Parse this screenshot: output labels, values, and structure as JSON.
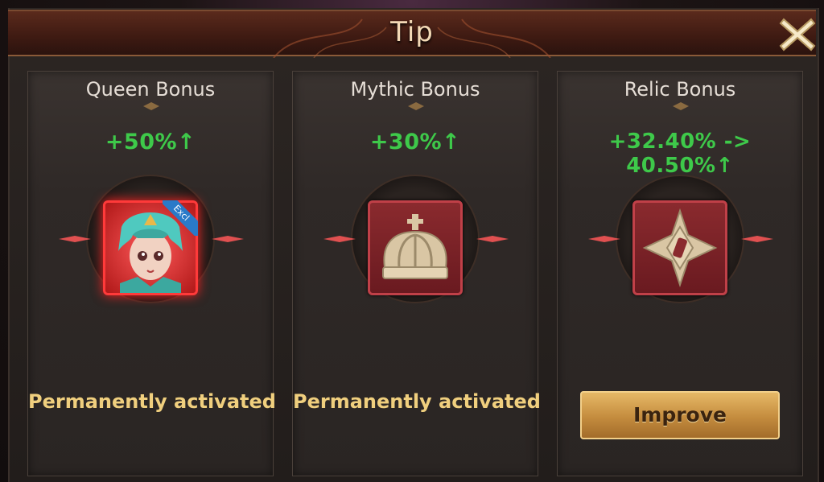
{
  "dialog": {
    "title": "Tip"
  },
  "panels": [
    {
      "title": "Queen Bonus",
      "bonus": "+50%↑",
      "icon": "queen-portrait-icon",
      "status": "Permanently activated",
      "badge": "Excl"
    },
    {
      "title": "Mythic Bonus",
      "bonus": "+30%↑",
      "icon": "crown-icon",
      "status": "Permanently activated"
    },
    {
      "title": "Relic Bonus",
      "bonus": "+32.40% -> 40.50%↑",
      "icon": "relic-icon",
      "button": "Improve"
    }
  ],
  "colors": {
    "bonus_green": "#3ec94a",
    "status_gold": "#f0cf7e",
    "title_text": "#f3d9b6"
  }
}
